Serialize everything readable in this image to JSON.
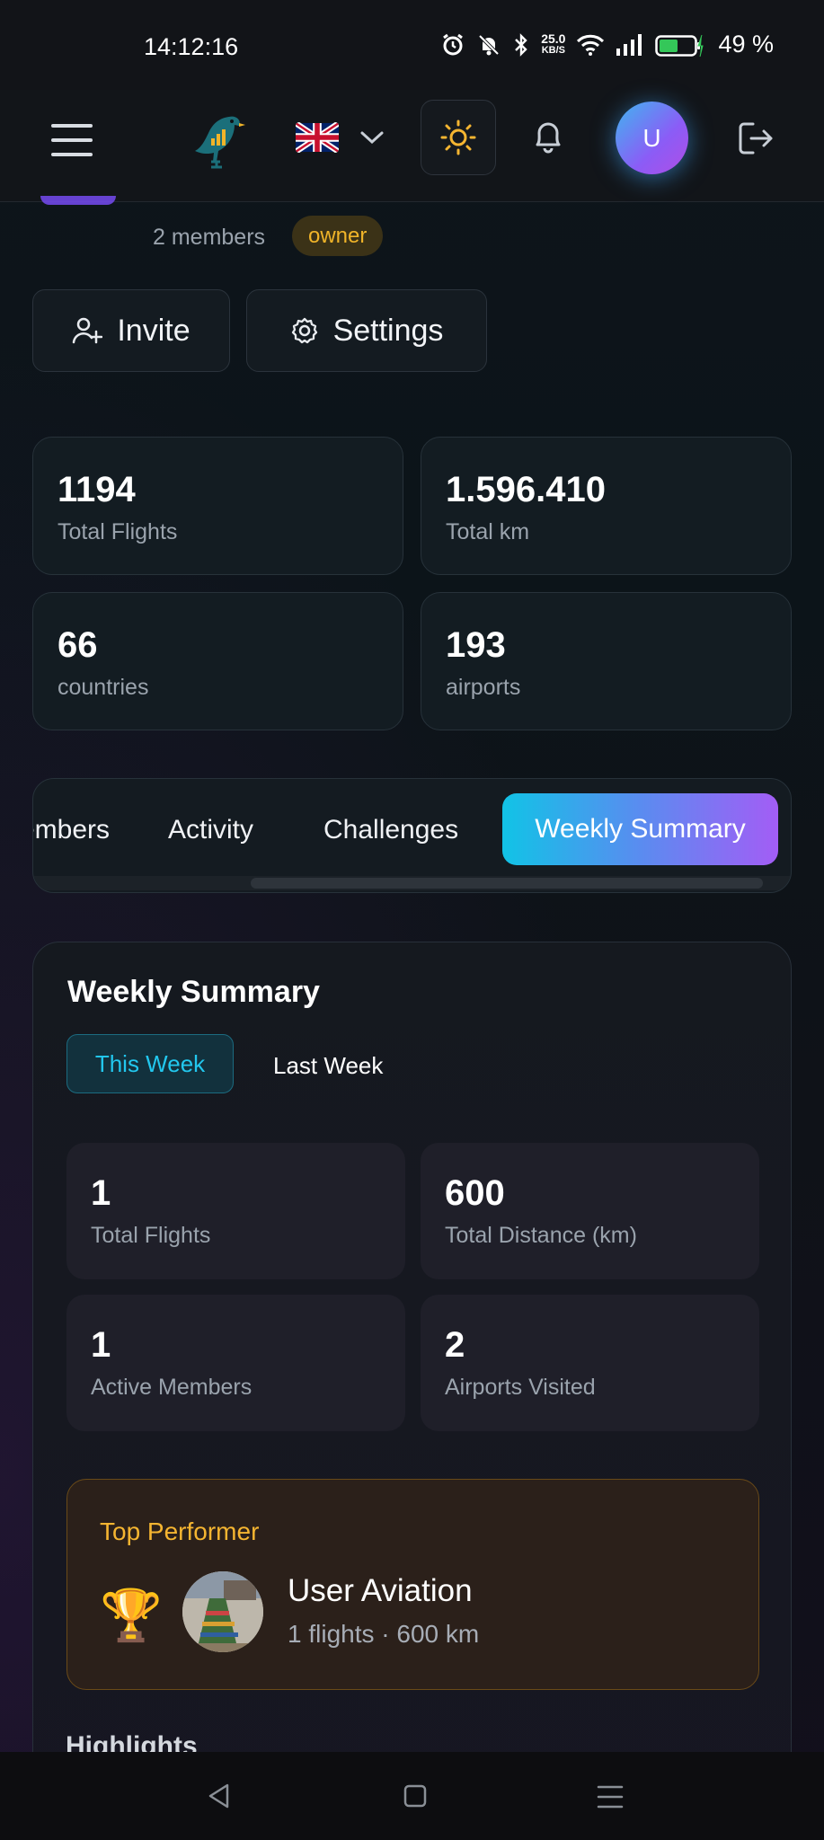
{
  "status_bar": {
    "time": "14:12:16",
    "net_speed_value": "25.0",
    "net_speed_unit": "KB/S",
    "battery_percent": "49 %"
  },
  "header": {
    "avatar_initial": "U",
    "icons": [
      "hamburger-menu-icon",
      "bird-logo",
      "uk-flag-icon",
      "chevron-down-icon",
      "sun-icon",
      "bell-icon",
      "logout-icon"
    ]
  },
  "group": {
    "members_text": "2 members",
    "role_badge": "owner",
    "invite_label": "Invite",
    "settings_label": "Settings"
  },
  "stats": [
    {
      "value": "1194",
      "label": "Total Flights"
    },
    {
      "value": "1.596.410",
      "label": "Total km"
    },
    {
      "value": "66",
      "label": "countries"
    },
    {
      "value": "193",
      "label": "airports"
    }
  ],
  "tabs": {
    "members": "Members",
    "activity": "Activity",
    "challenges": "Challenges",
    "weekly": "Weekly Summary",
    "active": "Weekly Summary"
  },
  "weekly_summary": {
    "title": "Weekly Summary",
    "this_week": "This Week",
    "last_week": "Last Week",
    "stats": [
      {
        "value": "1",
        "label": "Total Flights"
      },
      {
        "value": "600",
        "label": "Total Distance (km)"
      },
      {
        "value": "1",
        "label": "Active Members"
      },
      {
        "value": "2",
        "label": "Airports Visited"
      }
    ],
    "top_performer": {
      "title": "Top Performer",
      "trophy": "🏆",
      "name": "User Aviation",
      "details": "1 flights · 600 km"
    },
    "highlights_title": "Highlights"
  },
  "colors": {
    "accent_cyan": "#11c3e6",
    "accent_purple": "#a35df5",
    "owner_badge": "#f0b429",
    "top_performer": "#f5b531"
  }
}
